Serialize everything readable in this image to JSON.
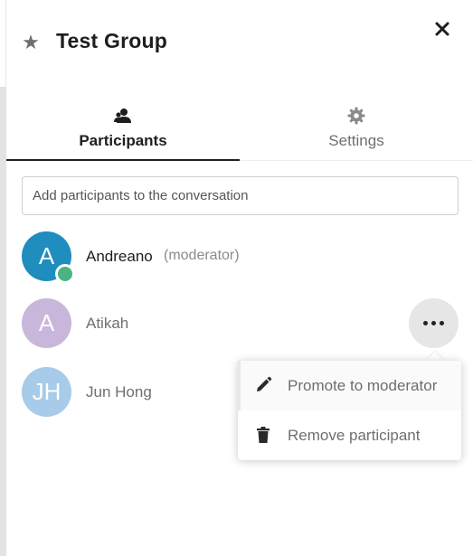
{
  "header": {
    "title": "Test Group",
    "star_icon": "star-icon",
    "close_icon": "close-icon"
  },
  "tabs": [
    {
      "label": "Participants",
      "icon": "contacts-icon",
      "active": true
    },
    {
      "label": "Settings",
      "icon": "gear-icon",
      "active": false
    }
  ],
  "search": {
    "placeholder": "Add participants to the conversation",
    "value": ""
  },
  "participants": [
    {
      "initials": "A",
      "name": "Andreano",
      "role": "(moderator)",
      "avatar_color": "#1f8dbd",
      "online": true
    },
    {
      "initials": "A",
      "name": "Atikah",
      "role": "",
      "avatar_color": "#c8b7da",
      "online": false
    },
    {
      "initials": "JH",
      "name": "Jun Hong",
      "role": "",
      "avatar_color": "#a7cbe8",
      "online": false
    }
  ],
  "actions_menu": {
    "items": [
      {
        "label": "Promote to moderator",
        "icon": "pencil-icon"
      },
      {
        "label": "Remove participant",
        "icon": "trash-icon"
      }
    ]
  },
  "colors": {
    "online_status": "#49b382",
    "more_button_bg": "#e6e6e6"
  }
}
